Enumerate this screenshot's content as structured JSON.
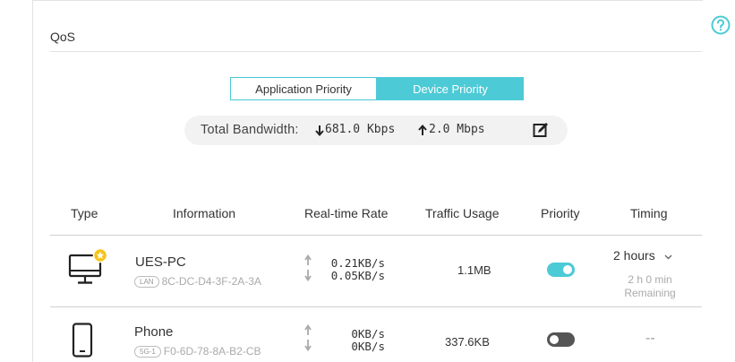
{
  "page": {
    "title": "QoS"
  },
  "tabs": [
    {
      "label": "Application Priority",
      "active": false
    },
    {
      "label": "Device Priority",
      "active": true
    }
  ],
  "bandwidth": {
    "label": "Total Bandwidth:",
    "download": "681.0 Kbps",
    "upload": "2.0 Mbps",
    "edit_icon": "edit-icon"
  },
  "table": {
    "headers": [
      "Type",
      "Information",
      "Real-time Rate",
      "Traffic Usage",
      "Priority",
      "Timing"
    ],
    "rows": [
      {
        "type_icon": "desktop-computer-icon",
        "name": "UES-PC",
        "conn": "LAN",
        "mac": "8C-DC-D4-3F-2A-3A",
        "up_rate": "0.21KB/s",
        "down_rate": "0.05KB/s",
        "usage": "1.1MB",
        "priority": true,
        "timing": "2 hours",
        "remaining_time": "2 h 0 min",
        "remaining_label": "Remaining"
      },
      {
        "type_icon": "smartphone-icon",
        "name": "Phone",
        "conn": "5G-1",
        "mac": "F0-6D-78-8A-B2-CB",
        "up_rate": "0KB/s",
        "down_rate": "0KB/s",
        "usage": "337.6KB",
        "priority": false,
        "timing": "--"
      }
    ]
  },
  "colors": {
    "accent": "#4ccad6",
    "star": "#f5c518",
    "toggle_off": "#555555"
  }
}
